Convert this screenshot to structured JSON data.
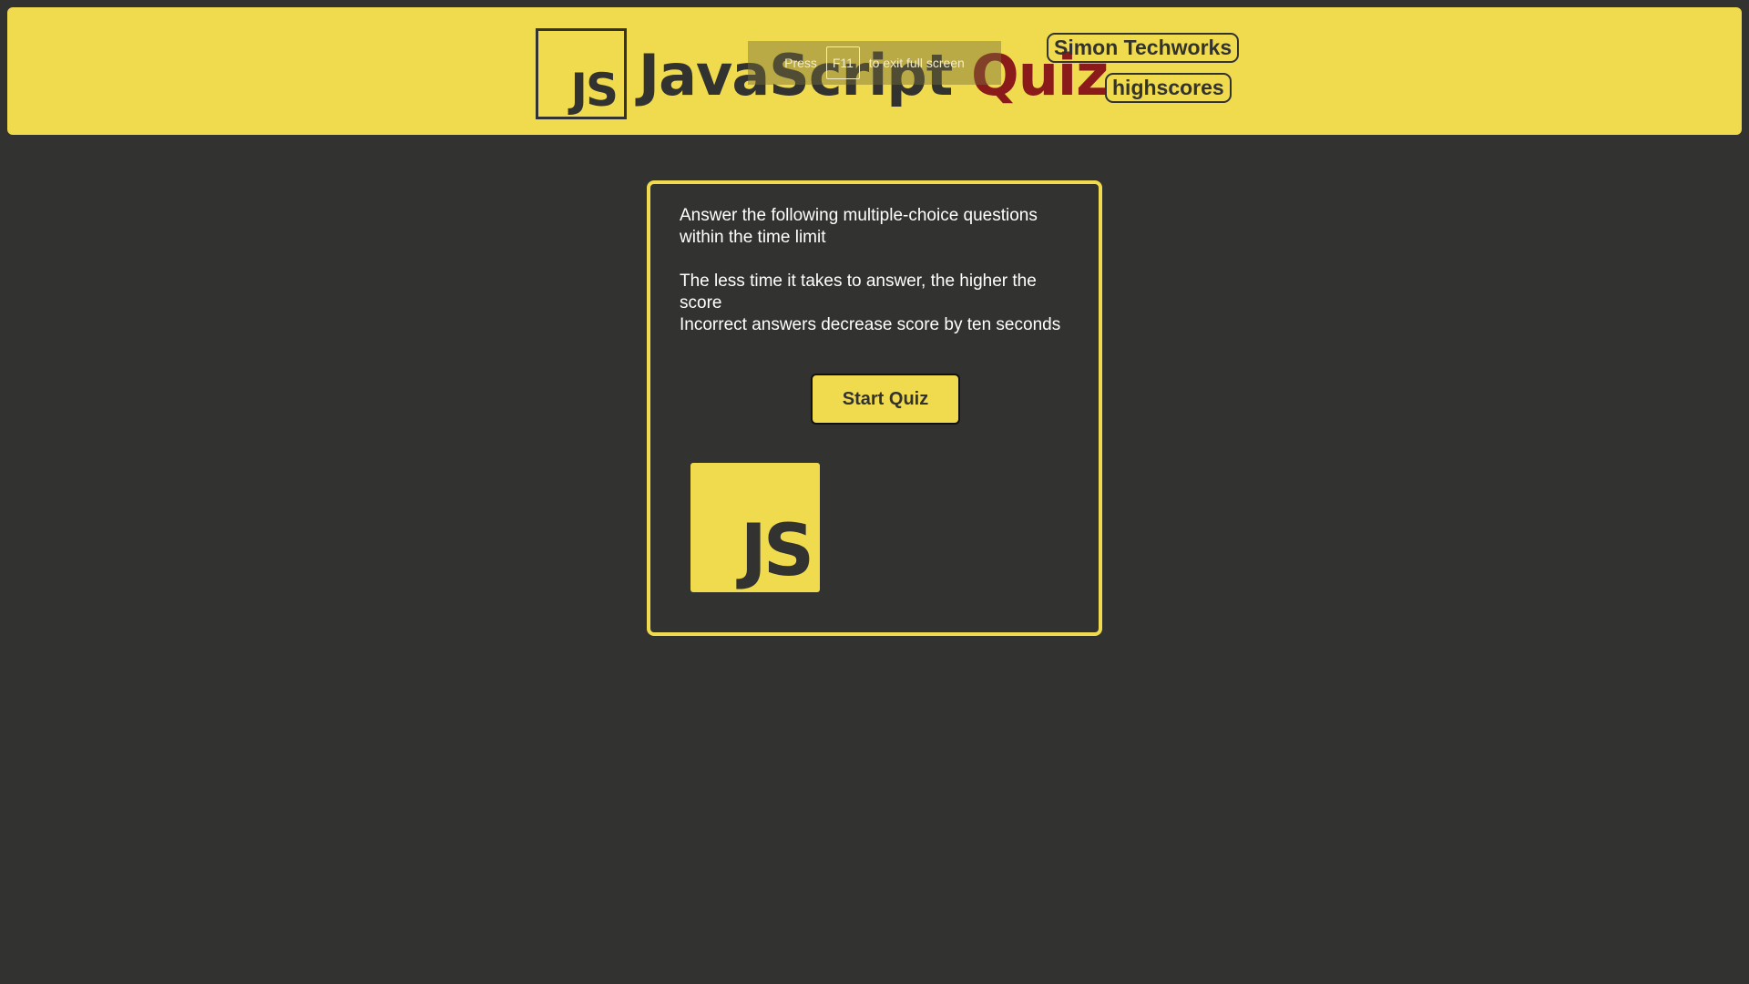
{
  "header": {
    "logo_text": "JS",
    "title_main": "JavaScript",
    "title_accent": "Quiz",
    "fullscreen_notice": {
      "prefix": "Press",
      "key": "F11",
      "suffix": "to exit full screen"
    },
    "nav": {
      "author_label": "Simon Techworks",
      "highscores_label": "highscores"
    }
  },
  "intro": {
    "line1": "Answer the following multiple-choice questions within the time limit",
    "line2": "The less time it takes to answer, the higher the score",
    "line3": "Incorrect answers decrease score by ten seconds",
    "start_label": "Start Quiz",
    "logo_text": "JS"
  },
  "colors": {
    "background": "#323230",
    "accent_yellow": "#f0db4f",
    "title_accent": "#8b1a1a"
  }
}
